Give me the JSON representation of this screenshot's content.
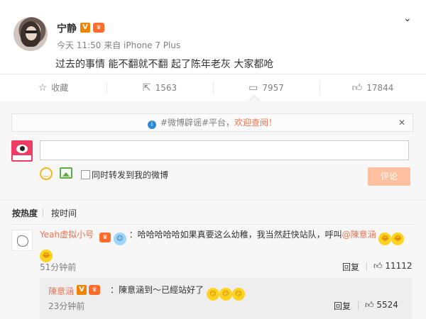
{
  "post": {
    "author": "宁静",
    "time": "今天 11:50",
    "source": "来自 iPhone 7 Plus",
    "text": "过去的事情 能不翻就不翻 起了陈年老灰 大家都呛"
  },
  "actions": {
    "favorite": "收藏",
    "repost_count": "1563",
    "comment_count": "7957",
    "like_count": "17844"
  },
  "notice": {
    "prefix": "#微博辟谣#平台，",
    "highlight": "欢迎查阅！"
  },
  "composer": {
    "forward_label": "同时转发到我的微博",
    "submit_label": "评论"
  },
  "sort": {
    "by_hot": "按热度",
    "by_time": "按时间"
  },
  "comments": [
    {
      "name": "Yeah虚拟小号",
      "text": "：哈哈哈哈哈如果真要这么幼稚，我当然赶快站队，呼叫",
      "mention": "@陳意涵",
      "time": "51分钟前",
      "reply": "回复",
      "likes": "11112"
    }
  ],
  "subcomment": {
    "name": "陳意涵",
    "text": "：陳意涵到～已經站好了",
    "time": "23分钟前",
    "reply": "回复",
    "likes": "5524"
  },
  "icons": {
    "favorite": "star-icon",
    "repost": "repost-icon",
    "comment": "comment-icon",
    "like": "thumb-up-icon",
    "dropdown": "chevron-down-icon",
    "info": "info-icon",
    "close": "close-icon",
    "emoji": "smile-icon",
    "image": "image-icon"
  },
  "colors": {
    "accent": "#eb7350",
    "verified": "#f08300",
    "submit_disabled": "#ffc09f",
    "info": "#2f8bd1"
  }
}
